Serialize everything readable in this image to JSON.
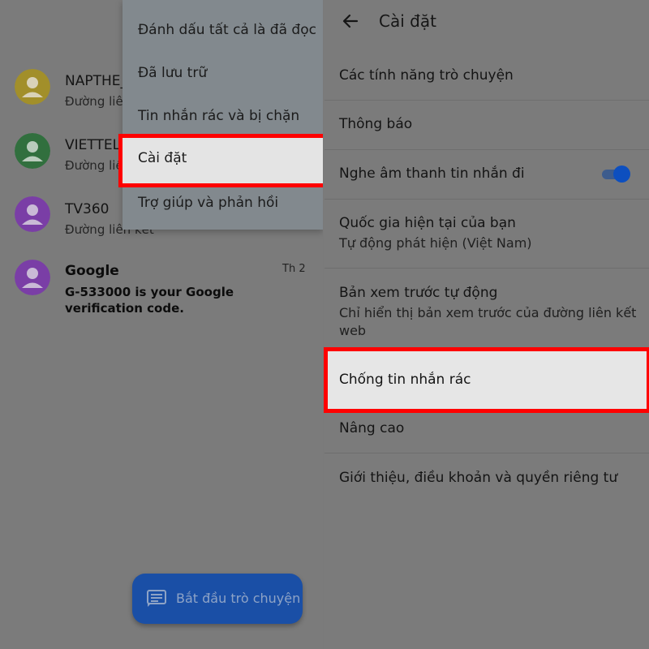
{
  "conversations": [
    {
      "name": "NAPTHE_",
      "subtitle": "Đường liên",
      "avatar_color": "#a28f2a"
    },
    {
      "name": "VIETTEL",
      "subtitle": "Đường liên",
      "avatar_color": "#316f3e"
    },
    {
      "name": "TV360",
      "subtitle": "Đường liên kết",
      "avatar_color": "#7a3ea6"
    },
    {
      "name": "Google",
      "message": "G-533000 is your Google verification code.",
      "time": "Th 2",
      "avatar_color": "#7a3ea6"
    }
  ],
  "menu": {
    "items": [
      {
        "label": "Đánh dấu tất cả là đã đọc"
      },
      {
        "label": "Đã lưu trữ"
      },
      {
        "label": "Tin nhắn rác và bị chặn"
      },
      {
        "label": "Cài đặt"
      },
      {
        "label": "Trợ giúp và phản hồi"
      }
    ]
  },
  "fab": {
    "label": "Bắt đầu trò chuyện",
    "icon": "message-icon"
  },
  "settings": {
    "title": "Cài đặt",
    "back_icon": "back-arrow-icon",
    "rows": [
      {
        "title": "Các tính năng trò chuyện"
      },
      {
        "title": "Thông báo"
      },
      {
        "title": "Nghe âm thanh tin nhắn đi",
        "toggle_on": true
      },
      {
        "title": "Quốc gia hiện tại của bạn",
        "subtitle": "Tự động phát hiện (Việt Nam)"
      },
      {
        "title": "Bản xem trước tự động",
        "subtitle": "Chỉ hiển thị bản xem trước của đường liên kết web"
      },
      {
        "title": "Chống tin nhắn rác"
      },
      {
        "title": "Nâng cao"
      },
      {
        "title": "Giới thiệu, điều khoản và quyền riêng tư"
      }
    ]
  },
  "colors": {
    "highlight_border": "#ff0000",
    "fab_bg": "#1a4fa6",
    "toggle_knob": "#0d4fbf"
  }
}
